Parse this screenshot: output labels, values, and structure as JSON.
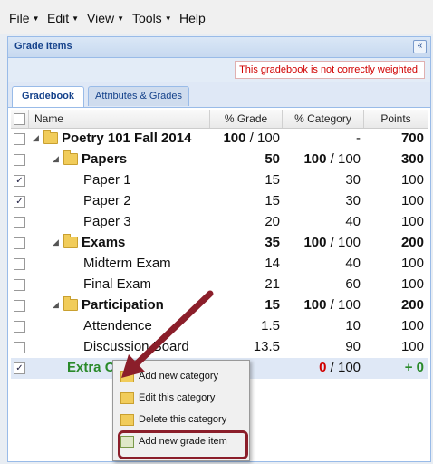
{
  "menubar": {
    "items": [
      "File",
      "Edit",
      "View",
      "Tools",
      "Help"
    ]
  },
  "panel": {
    "title": "Grade Items",
    "collapse_glyph": "«",
    "warning": "This gradebook is not correctly weighted."
  },
  "tabs": [
    "Gradebook",
    "Attributes & Grades"
  ],
  "columns": [
    "Name",
    "% Grade",
    "% Category",
    "Points"
  ],
  "rows": [
    {
      "name": "Poetry 101 Fall 2014",
      "grade": "100",
      "grade_suffix": " / 100",
      "category": "-",
      "points": "700"
    },
    {
      "name": "Papers",
      "grade": "50",
      "category": "100",
      "category_suffix": " / 100",
      "points": "300"
    },
    {
      "name": "Paper 1",
      "grade": "15",
      "category": "30",
      "points": "100"
    },
    {
      "name": "Paper 2",
      "grade": "15",
      "category": "30",
      "points": "100"
    },
    {
      "name": "Paper 3",
      "grade": "20",
      "category": "40",
      "points": "100"
    },
    {
      "name": "Exams",
      "grade": "35",
      "category": "100",
      "category_suffix": " / 100",
      "points": "200"
    },
    {
      "name": "Midterm Exam",
      "grade": "14",
      "category": "40",
      "points": "100"
    },
    {
      "name": "Final Exam",
      "grade": "21",
      "category": "60",
      "points": "100"
    },
    {
      "name": "Participation",
      "grade": "15",
      "category": "100",
      "category_suffix": " / 100",
      "points": "200"
    },
    {
      "name": "Attendence",
      "grade": "1.5",
      "category": "10",
      "points": "100"
    },
    {
      "name": "Discussion Board",
      "grade": "13.5",
      "category": "90",
      "points": "100"
    },
    {
      "name": "Extra Credit",
      "category": "0",
      "category_suffix": " / 100",
      "points": "+ 0"
    }
  ],
  "context_menu": [
    "Add new category",
    "Edit this category",
    "Delete this category",
    "Add new grade item"
  ],
  "colors": {
    "accent": "#15428b",
    "warning": "#d00000",
    "extra_credit": "#2a8a2a",
    "highlight": "#8b1e2a"
  }
}
